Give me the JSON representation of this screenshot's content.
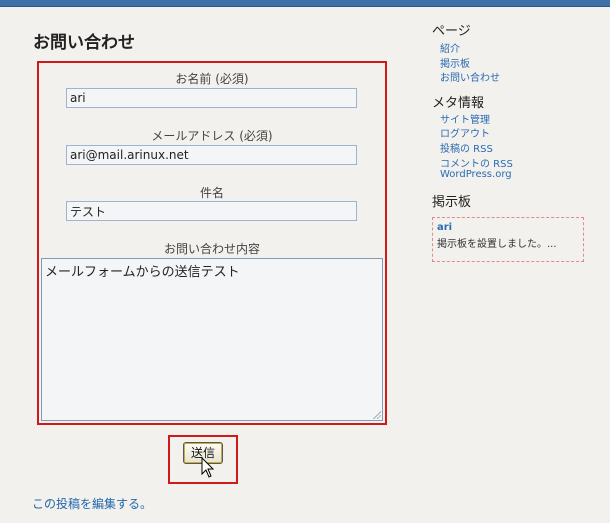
{
  "page": {
    "title": "お問い合わせ"
  },
  "form": {
    "name_label": "お名前 (必須)",
    "name_value": "ari",
    "email_label": "メールアドレス (必須)",
    "email_value": "ari@mail.arinux.net",
    "subject_label": "件名",
    "subject_value": "テスト",
    "message_label": "お問い合わせ内容",
    "message_value": "メールフォームからの送信テスト",
    "submit_label": "送信"
  },
  "edit_link": "この投稿を編集する。",
  "sidebar": {
    "pages": {
      "heading": "ページ",
      "items": [
        "紹介",
        "掲示板",
        "お問い合わせ"
      ]
    },
    "meta": {
      "heading": "メタ情報",
      "items": [
        "サイト管理",
        "ログアウト",
        "投稿の RSS",
        "コメントの RSS",
        "WordPress.org"
      ]
    },
    "bbs": {
      "heading": "掲示板",
      "author": "ari",
      "text": "掲示板を設置しました。..."
    }
  },
  "colors": {
    "highlight_border": "#d01a1a",
    "link": "#2a6bb0",
    "top_bar": "#3d71a8"
  }
}
